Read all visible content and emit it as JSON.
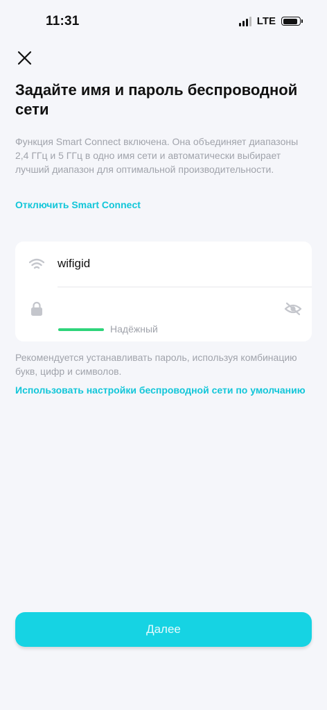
{
  "status_bar": {
    "time": "11:31",
    "network": "LTE"
  },
  "header": {
    "close_icon": "close-icon",
    "title": "Задайте имя и пароль беспроводной сети"
  },
  "info": {
    "description": "Функция Smart Connect включена. Она объединяет диапазоны 2,4 ГГц и 5 ГГц в одно имя сети и автоматически выбирает лучший диапазон для оптимальной производительности.",
    "smart_connect_link": "Отключить Smart Connect"
  },
  "form": {
    "ssid_icon": "wifi-icon",
    "ssid_value": "wifigid",
    "password_icon": "lock-icon",
    "password_value": "",
    "visibility_icon": "eye-off-icon",
    "strength_label": "Надёжный",
    "strength_color": "#2ed47a"
  },
  "hint": "Рекомендуется устанавливать пароль, используя комбинацию букв, цифр и символов.",
  "default_settings_link": "Использовать настройки беспроводной сети по умолчанию",
  "next_button": "Далее",
  "colors": {
    "accent": "#16d3e3",
    "link": "#12c6d9",
    "background": "#f5f6fa"
  }
}
